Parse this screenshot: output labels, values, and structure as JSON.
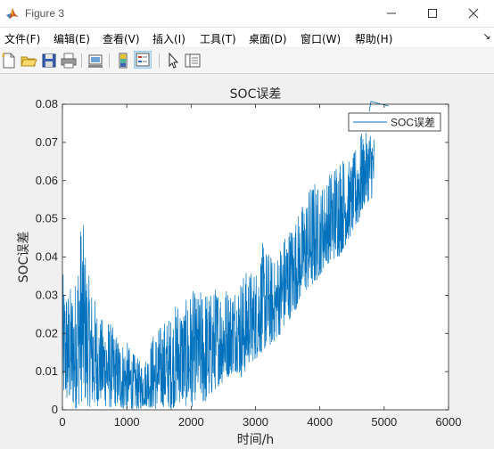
{
  "window": {
    "title": "Figure 3",
    "icon": "matlab-icon",
    "controls": [
      "minimize-icon",
      "maximize-icon",
      "close-icon"
    ]
  },
  "menu": {
    "items": [
      "文件(F)",
      "编辑(E)",
      "查看(V)",
      "插入(I)",
      "工具(T)",
      "桌面(D)",
      "窗口(W)",
      "帮助(H)"
    ],
    "overflow_icon": "chevron-icon"
  },
  "toolbar": {
    "icons": [
      "new-figure-icon",
      "open-icon",
      "save-icon",
      "print-icon",
      "link-plot-icon",
      "colorbar-icon",
      "legend-icon",
      "pointer-icon",
      "property-inspector-icon"
    ],
    "active": "legend-icon"
  },
  "chart_data": {
    "type": "line",
    "title": "SOC误差",
    "xlabel": "时间/h",
    "ylabel": "SOC误差",
    "xlim": [
      0,
      6000
    ],
    "ylim": [
      0,
      0.08
    ],
    "xticks": [
      "0",
      "1000",
      "2000",
      "3000",
      "4000",
      "5000",
      "6000"
    ],
    "yticks": [
      "0",
      "0.01",
      "0.02",
      "0.03",
      "0.04",
      "0.05",
      "0.06",
      "0.07",
      "0.08"
    ],
    "grid": false,
    "legend_position": "top-right",
    "series": [
      {
        "name": "SOC误差",
        "color": "#0072bd",
        "x": [
          0,
          100,
          200,
          300,
          400,
          500,
          600,
          700,
          800,
          900,
          1000,
          1100,
          1200,
          1300,
          1400,
          1500,
          1600,
          1700,
          1800,
          1900,
          2000,
          2100,
          2200,
          2300,
          2400,
          2500,
          2600,
          2700,
          2800,
          2900,
          3000,
          3100,
          3200,
          3300,
          3400,
          3500,
          3600,
          3700,
          3800,
          3900,
          4000,
          4100,
          4200,
          4300,
          4400,
          4500,
          4600,
          4700,
          4800,
          4850
        ],
        "y_upper": [
          0.036,
          0.032,
          0.035,
          0.053,
          0.036,
          0.03,
          0.024,
          0.025,
          0.021,
          0.019,
          0.018,
          0.015,
          0.013,
          0.014,
          0.02,
          0.022,
          0.024,
          0.025,
          0.03,
          0.028,
          0.032,
          0.03,
          0.033,
          0.031,
          0.033,
          0.034,
          0.032,
          0.034,
          0.036,
          0.037,
          0.037,
          0.044,
          0.042,
          0.039,
          0.045,
          0.048,
          0.05,
          0.053,
          0.057,
          0.061,
          0.058,
          0.061,
          0.064,
          0.068,
          0.066,
          0.065,
          0.073,
          0.072,
          0.075,
          0.072
        ],
        "y_lower": [
          0.002,
          0.001,
          0.0,
          0.002,
          0.001,
          0.0,
          0.002,
          0.0,
          0.001,
          0.0,
          0.0,
          0.0,
          0.0,
          0.001,
          0.0,
          0.0,
          0.001,
          0.0,
          0.002,
          0.001,
          0.0,
          0.004,
          0.001,
          0.003,
          0.006,
          0.007,
          0.009,
          0.01,
          0.008,
          0.012,
          0.013,
          0.015,
          0.016,
          0.018,
          0.02,
          0.023,
          0.025,
          0.029,
          0.031,
          0.032,
          0.035,
          0.038,
          0.039,
          0.04,
          0.043,
          0.046,
          0.048,
          0.054,
          0.055,
          0.057
        ]
      }
    ]
  }
}
